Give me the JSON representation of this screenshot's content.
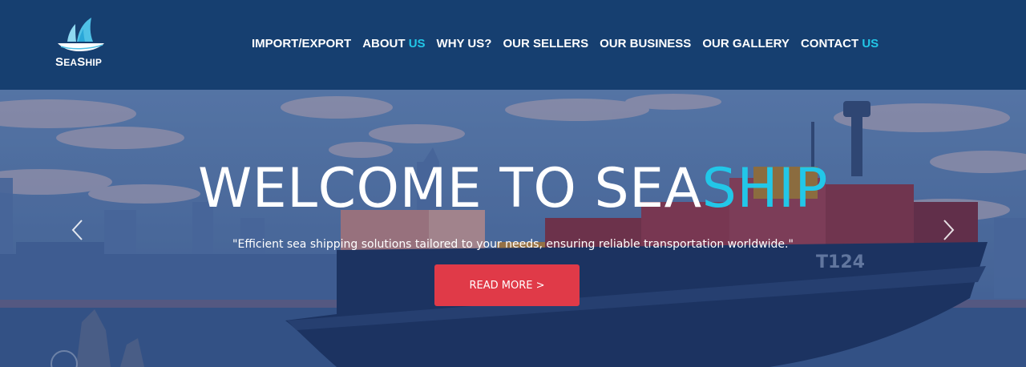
{
  "brand": {
    "name_big_1": "S",
    "name_small_1": "EA",
    "name_big_2": "S",
    "name_small_2": "HIP",
    "colors": {
      "header_bg": "#163f70",
      "accent": "#22c7e8",
      "cta_bg": "#e03a48"
    }
  },
  "nav": {
    "items": [
      {
        "main": "IMPORT/EXPORT",
        "highlight": ""
      },
      {
        "main": "ABOUT ",
        "highlight": "US"
      },
      {
        "main": "WHY US?",
        "highlight": ""
      },
      {
        "main": "OUR SELLERS",
        "highlight": ""
      },
      {
        "main": "OUR BUSINESS",
        "highlight": ""
      },
      {
        "main": "OUR GALLERY",
        "highlight": ""
      },
      {
        "main": "CONTACT ",
        "highlight": "US"
      }
    ]
  },
  "hero": {
    "title_main": "WELCOME TO SEA",
    "title_accent": "SHIP",
    "subtitle": "\"Efficient sea shipping solutions tailored to your needs, ensuring reliable transportation worldwide.\"",
    "cta_label": "READ MORE >",
    "ship_marking": "T124",
    "prev_icon": "chevron-left-icon",
    "next_icon": "chevron-right-icon"
  }
}
